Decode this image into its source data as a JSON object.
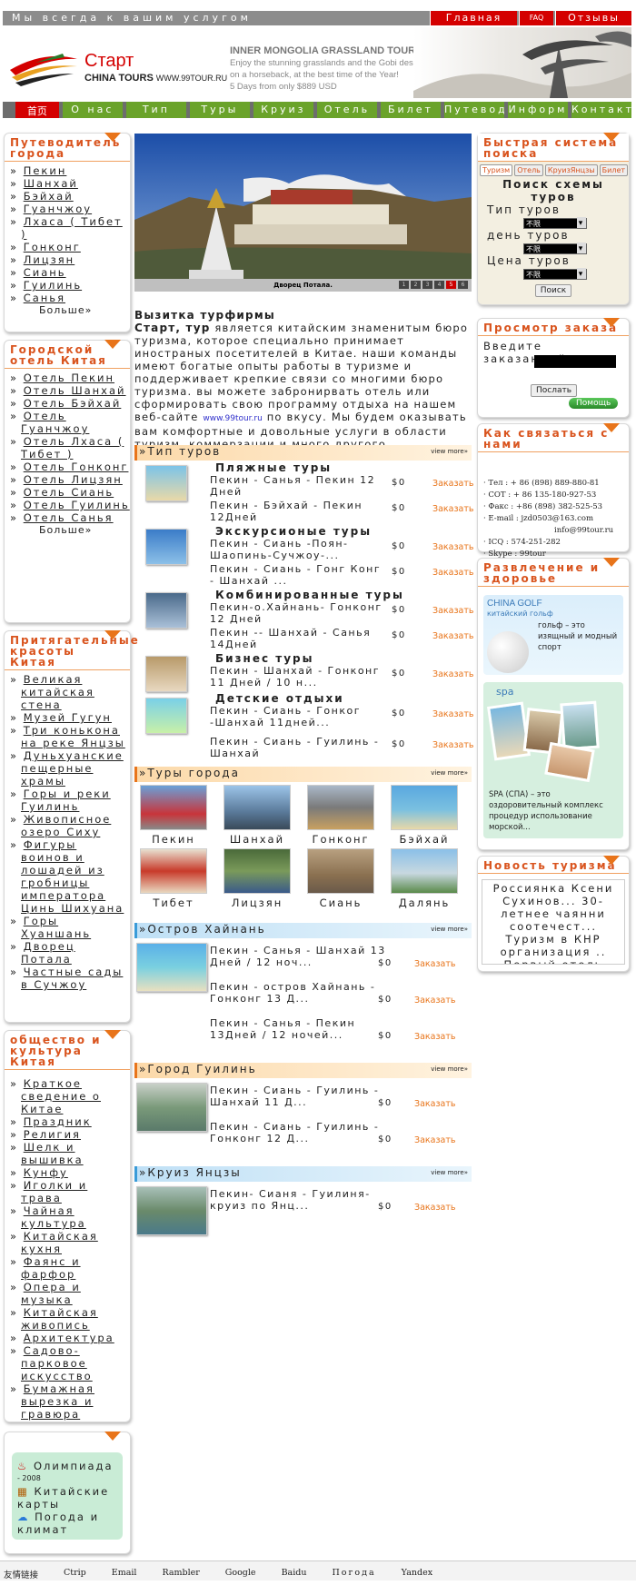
{
  "top": {
    "slogan": "Мы всегда к вашим услугом",
    "nav": [
      "Главная",
      "FAQ",
      "Отзывы"
    ]
  },
  "header": {
    "brand": "Старт",
    "sub": "CHINA TOURS",
    "url": "WWW.99TOUR.RU",
    "promo_title": "INNER MONGOLIA GRASSLAND TOURS",
    "promo_1": "Enjoy the stunning grasslands and the Gobi desert",
    "promo_2": "on a horseback, at the best time of the Year!",
    "promo_3": "5 Days from only $889 USD"
  },
  "mainnav": [
    "首页",
    "О нас",
    "Тип",
    "Туры",
    "Круиз",
    "Отель",
    "Билет",
    "Путевод",
    "Информ",
    "Контакт"
  ],
  "left": {
    "guide": {
      "title": "Путеводитель города",
      "items": [
        "Пекин",
        "Шанхай",
        "Бэйхай",
        "Гуанчжоу",
        "Лхаса ( Тибет )",
        "Гонконг",
        "Лицзян",
        "Сиань",
        "Гуилинь",
        "Санья"
      ],
      "more": "Больше»"
    },
    "hotels": {
      "title": "Городской отель Китая",
      "items": [
        "Отель Пекин",
        "Отель Шанхай",
        "Отель Бэйхай",
        "Отель Гуанчжоу",
        "Отель Лхаса ( Тибет )",
        "Отель Гонконг",
        "Отель Лицзян",
        "Отель Сиань",
        "Отель Гуилинь",
        "Отель Санья"
      ],
      "more": "Больше»"
    },
    "sights": {
      "title": "Притягательные красоты Китая",
      "items": [
        "Великая китайская стена",
        "Музей Гугун",
        "Три конькона на реке Янцзы",
        "Дуньхуанские пещерные храмы",
        "Горы и реки Гуилинь",
        "Живописное озеро Сиху",
        "Фигуры воинов и лошадей из гробницы императора Цинь Шихуана",
        "Горы Хуаншань",
        "Дворец Потала",
        "Частные сады в Сучжоу"
      ]
    },
    "culture": {
      "title": "общество и культура Китая",
      "items": [
        "Краткое сведение о Китае",
        "Праздник",
        "Религия",
        "Шелк и вышивка",
        "Кунфу",
        "Иголки и трава",
        "Чайная культура",
        "Китайская кухня",
        "Фаянс и фарфор",
        "Опера и музыка",
        "Китайская живопись",
        "Архитектура",
        "Садово-парковое искусство",
        "Бумажная вырезка и гравюра"
      ]
    },
    "extra": {
      "olympic": "Олимпиада",
      "year": "- 2008",
      "maps": "Китайские карты",
      "weather": "Погода и климат"
    }
  },
  "center": {
    "hero_caption": "Дворец Потала.",
    "hero_dots": [
      "1",
      "2",
      "3",
      "4",
      "5",
      "6"
    ],
    "intro_title": "Вызитка турфирмы",
    "intro_brand": "Старт, тур",
    "intro_text": "является китайским знаменитым бюро туризма, которое специально принимает иностраных посетителей в Китае. наши команды имеют богатые опыты работы в туризме и поддерживает крепкие связи со многими бюро туризма. вы можете забронирвать отель или сформировать свою программу отдыха на нашем веб-сайте",
    "intro_url": "www.99tour.ru",
    "intro_tail": "по вкусу. Мы будем оказывать вам комфортные и довольные услуги в области туризм, коммерзации и много другого.",
    "view_more": "view more»",
    "types": {
      "title": "Тип туров",
      "cats": [
        "Пляжные туры",
        "Экскурсионые туры",
        "Комбинированные туры",
        "Бизнес туры",
        "Детские отдыхи"
      ],
      "rows": [
        {
          "t": "Пекин - Санья - Пекин 12 Дней",
          "p": "$0",
          "o": "Заказать"
        },
        {
          "t": "Пекин - Бэйхай - Пекин 12Дней",
          "p": "$0",
          "o": "Заказать"
        },
        {
          "t": "Пекин - Сиань -Поян- Шаопинь-Сучжоу-...",
          "p": "$0",
          "o": "Заказать"
        },
        {
          "t": "Пекин - Сиань - Гонг Конг - Шанхай ...",
          "p": "$0",
          "o": "Заказать"
        },
        {
          "t": "Пекин-о.Хайнань- Гонконг 12 Дней",
          "p": "$0",
          "o": "Заказать"
        },
        {
          "t": "Пекин -- Шанхай - Санья 14Дней",
          "p": "$0",
          "o": "Заказать"
        },
        {
          "t": "Пекин - Шанхай - Гонконг 11 Дней / 10 н...",
          "p": "$0",
          "o": "Заказать"
        },
        {
          "t": "Пекин - Сиань - Гонког -Шанхай 11дней...",
          "p": "$0",
          "o": "Заказать"
        },
        {
          "t": "Пекин - Сиань - Гуилинь - Шанхай",
          "p": "$0",
          "o": "Заказать"
        }
      ]
    },
    "cities": {
      "title": "Туры города",
      "items": [
        "Пекин",
        "Шанхай",
        "Гонконг",
        "Бэйхай",
        "Тибет",
        "Лицзян",
        "Сиань",
        "Далянь"
      ]
    },
    "hainan": {
      "title": "Остров Хайнань",
      "rows": [
        {
          "t": "Пекин - Санья - Шанхай 13 Дней / 12 ноч...",
          "p": "$0",
          "o": "Заказать"
        },
        {
          "t": "Пекин - остров Хайнань - Гонконг 13 Д...",
          "p": "$0",
          "o": "Заказать"
        },
        {
          "t": "Пекин - Санья - Пекин 13Дней / 12 ночей...",
          "p": "$0",
          "o": "Заказать"
        }
      ]
    },
    "guilin": {
      "title": "Город Гуилинь",
      "rows": [
        {
          "t": "Пекин - Сиань - Гуилинь - Шанхай 11 Д...",
          "p": "$0",
          "o": "Заказать"
        },
        {
          "t": "Пекин - Сиань - Гуилинь - Гонконг 12 Д...",
          "p": "$0",
          "o": "Заказать"
        }
      ]
    },
    "cruise": {
      "title": "Круиз Янцзы",
      "rows": [
        {
          "t": "Пекин- Сианя - Гуилиня- круиз по Янц...",
          "p": "$0",
          "o": "Заказать"
        }
      ]
    }
  },
  "right": {
    "search": {
      "title": "Быстрая система поиска",
      "tabs": [
        "Туризм",
        "Отель",
        "КруизЯнцзы",
        "Билет"
      ],
      "heading": "Поиск схемы туров",
      "l1": "Тип туров",
      "l2": "день туров",
      "l3": "Цена туров",
      "opt": "不限",
      "btn": "Поиск"
    },
    "order": {
      "title": "Просмотр заказа",
      "label": "Введите заказанный номер",
      "send": "Послать",
      "help": "Помощь"
    },
    "contact": {
      "title": "Как связаться с нами",
      "lines": [
        "· Тел : + 86 (898) 889-880-81",
        "· СОТ : + 86 135-180-927-53",
        "· Факс : +86 (898) 382-525-53",
        "· E-mail : jzd0503@163.com",
        "info@99tour.ru",
        "· ICQ : 574-251-282",
        "· Skype : 99tour"
      ]
    },
    "fun": {
      "title": "Развлечение и здоровье",
      "golf_t": "CHINA GOLF",
      "golf_s": "китайский гольф",
      "golf_d": "гольф – это изящный и модный спорт",
      "spa_t": "spa",
      "spa_d": "SPA (СПА) – это оздоровительный комплекс процедур использование морской..."
    },
    "news": {
      "title": "Новость туризма",
      "text": "Россиянка Ксени Сухинов... 30-летнее чаянни соотечест... Туризм в КНР организация .. Первый отель Indig. азии бу"
    }
  },
  "footer": {
    "label": "友情链接",
    "links": [
      "Ctrip",
      "Email",
      "Rambler",
      "Google",
      "Baidu",
      "Погода",
      "Yandex"
    ]
  }
}
